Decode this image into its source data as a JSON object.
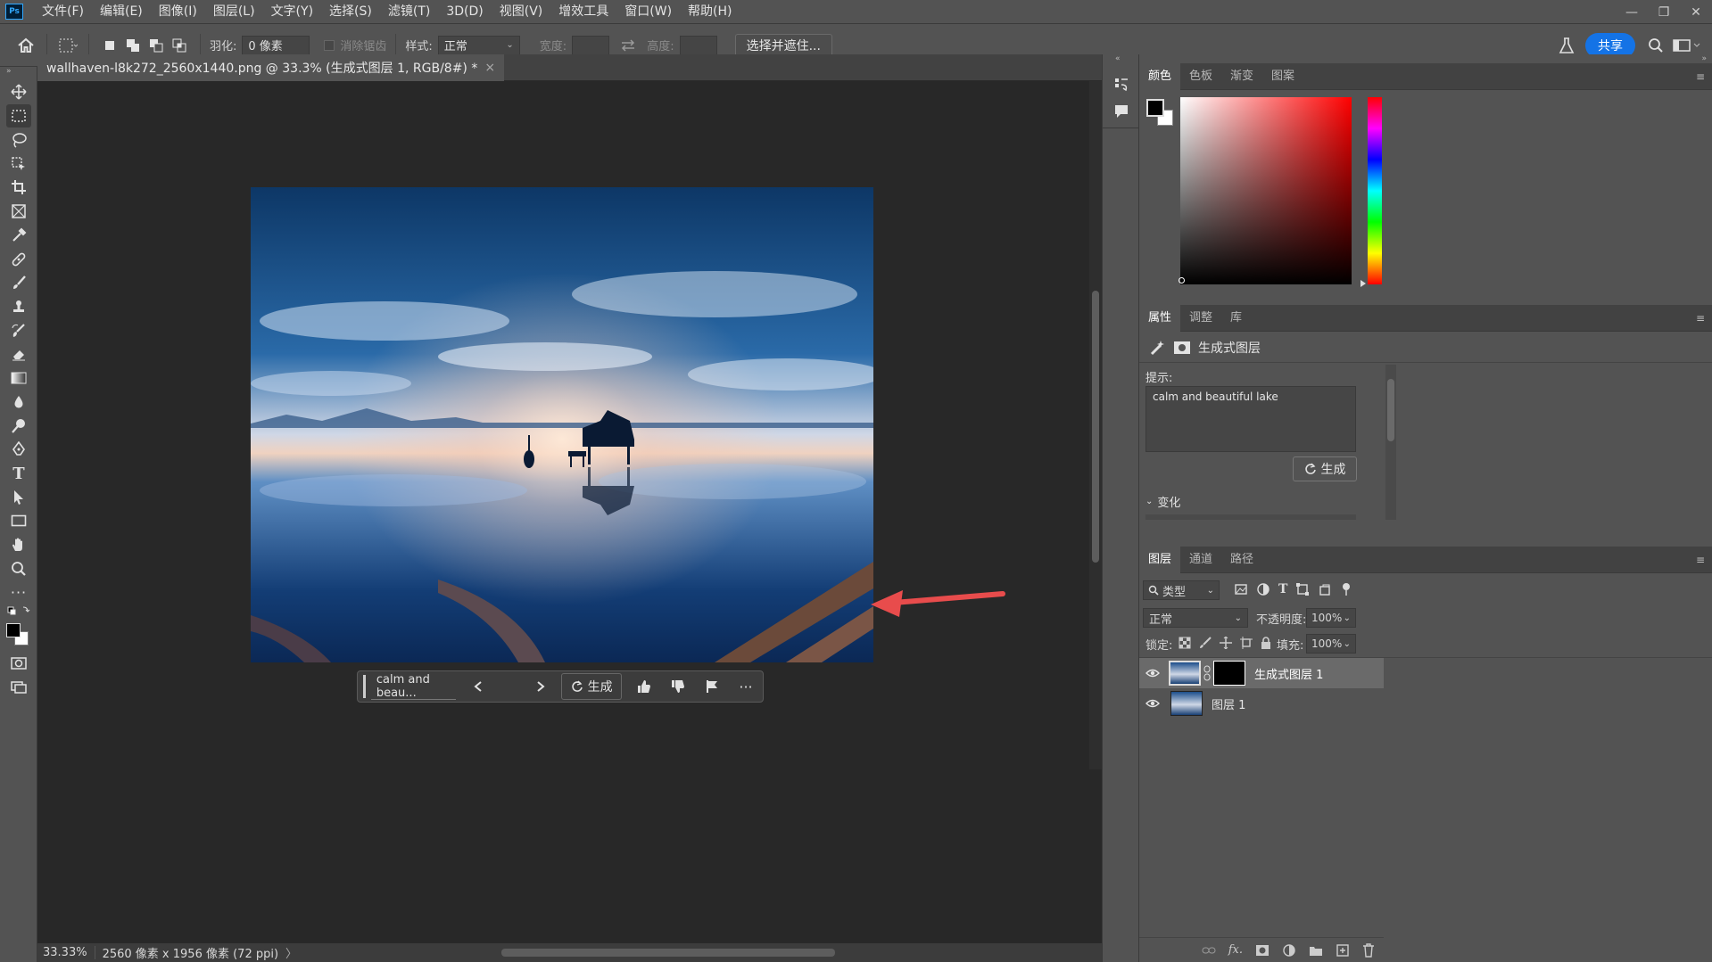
{
  "app": {
    "logo": "Ps"
  },
  "menu": [
    "文件(F)",
    "编辑(E)",
    "图像(I)",
    "图层(L)",
    "文字(Y)",
    "选择(S)",
    "滤镜(T)",
    "3D(D)",
    "视图(V)",
    "增效工具",
    "窗口(W)",
    "帮助(H)"
  ],
  "window_controls": {
    "minimize": "—",
    "restore": "❐",
    "close": "✕"
  },
  "options": {
    "feather_label": "羽化:",
    "feather_value": "0 像素",
    "antialias_label": "消除锯齿",
    "style_label": "样式:",
    "style_value": "正常",
    "width_label": "宽度:",
    "height_label": "高度:",
    "select_mask_button": "选择并遮住...",
    "share_button": "共享"
  },
  "document": {
    "tab_title": "wallhaven-l8k272_2560x1440.png @ 33.3% (生成式图层 1, RGB/8#) *",
    "tab_close": "×"
  },
  "contextbar": {
    "prompt_text": "calm and beau...",
    "generate_label": "生成",
    "more": "···"
  },
  "status": {
    "zoom": "33.33%",
    "doc_info": "2560 像素 x 1956 像素 (72 ppi)",
    "arrow": "〉"
  },
  "color_panel": {
    "tabs": [
      "颜色",
      "色板",
      "渐变",
      "图案"
    ]
  },
  "properties_panel": {
    "tabs": [
      "属性",
      "调整",
      "库"
    ],
    "layer_type": "生成式图层",
    "prompt_label": "提示:",
    "prompt_value": "calm and beautiful lake",
    "generate_label": "生成",
    "variations_label": "变化"
  },
  "layers_panel": {
    "tabs": [
      "图层",
      "通道",
      "路径"
    ],
    "filter_label": "类型",
    "blend_mode": "正常",
    "opacity_label": "不透明度:",
    "opacity_value": "100%",
    "lock_label": "锁定:",
    "fill_label": "填充:",
    "fill_value": "100%",
    "layers": [
      {
        "name": "生成式图层 1"
      },
      {
        "name": "图层 1"
      }
    ]
  },
  "colors": {
    "accent": "#1473e6",
    "annotation_arrow": "#e84c4c"
  }
}
